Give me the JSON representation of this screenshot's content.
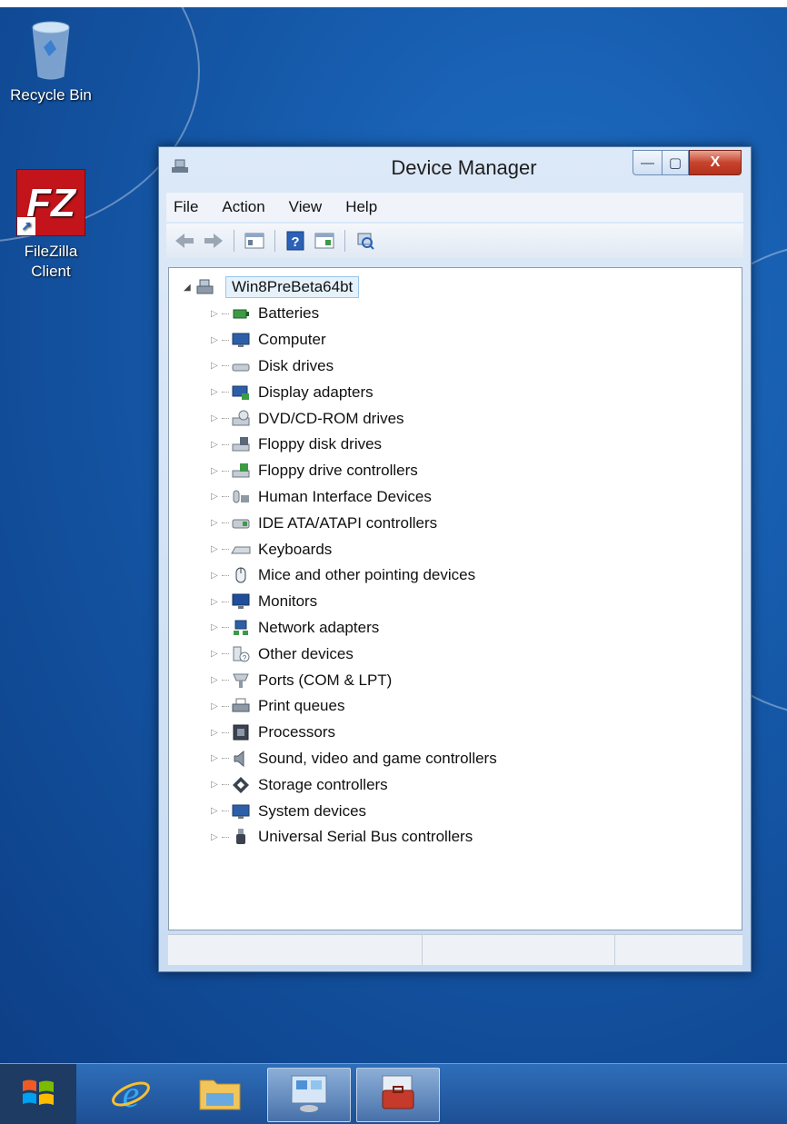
{
  "desktop": {
    "icons": [
      {
        "name": "recycle-bin",
        "label": "Recycle Bin"
      },
      {
        "name": "filezilla",
        "label_line1": "FileZilla",
        "label_line2": "Client",
        "glyph": "FZ"
      }
    ]
  },
  "window": {
    "title": "Device Manager",
    "caption": {
      "minimize": "—",
      "maximize": "▢",
      "close": "X"
    },
    "menu": [
      "File",
      "Action",
      "View",
      "Help"
    ],
    "toolbar": [
      "back-icon",
      "forward-icon",
      "show-hide-console-tree-icon",
      "help-icon",
      "properties-icon",
      "scan-hardware-icon"
    ],
    "tree": {
      "root": "Win8PreBeta64bt",
      "categories": [
        {
          "label": "Batteries",
          "icon": "battery-icon"
        },
        {
          "label": "Computer",
          "icon": "computer-icon"
        },
        {
          "label": "Disk drives",
          "icon": "disk-drive-icon"
        },
        {
          "label": "Display adapters",
          "icon": "display-adapter-icon"
        },
        {
          "label": "DVD/CD-ROM drives",
          "icon": "dvd-icon"
        },
        {
          "label": "Floppy disk drives",
          "icon": "floppy-disk-icon"
        },
        {
          "label": "Floppy drive controllers",
          "icon": "floppy-controller-icon"
        },
        {
          "label": "Human Interface Devices",
          "icon": "hid-icon"
        },
        {
          "label": "IDE ATA/ATAPI controllers",
          "icon": "ide-controller-icon"
        },
        {
          "label": "Keyboards",
          "icon": "keyboard-icon"
        },
        {
          "label": "Mice and other pointing devices",
          "icon": "mouse-icon"
        },
        {
          "label": "Monitors",
          "icon": "monitor-icon"
        },
        {
          "label": "Network adapters",
          "icon": "network-adapter-icon"
        },
        {
          "label": "Other devices",
          "icon": "unknown-device-icon"
        },
        {
          "label": "Ports (COM & LPT)",
          "icon": "port-icon"
        },
        {
          "label": "Print queues",
          "icon": "printer-icon"
        },
        {
          "label": "Processors",
          "icon": "processor-icon"
        },
        {
          "label": "Sound, video and game controllers",
          "icon": "speaker-icon"
        },
        {
          "label": "Storage controllers",
          "icon": "storage-controller-icon"
        },
        {
          "label": "System devices",
          "icon": "system-device-icon"
        },
        {
          "label": "Universal Serial Bus controllers",
          "icon": "usb-icon"
        }
      ]
    }
  },
  "taskbar": {
    "items": [
      {
        "name": "start-button",
        "icon": "windows-logo-icon"
      },
      {
        "name": "taskbar-internet-explorer",
        "icon": "internet-explorer-icon"
      },
      {
        "name": "taskbar-file-explorer",
        "icon": "file-explorer-icon"
      },
      {
        "name": "taskbar-control-panel",
        "icon": "control-panel-icon"
      },
      {
        "name": "taskbar-device-manager",
        "icon": "device-manager-icon"
      }
    ]
  }
}
